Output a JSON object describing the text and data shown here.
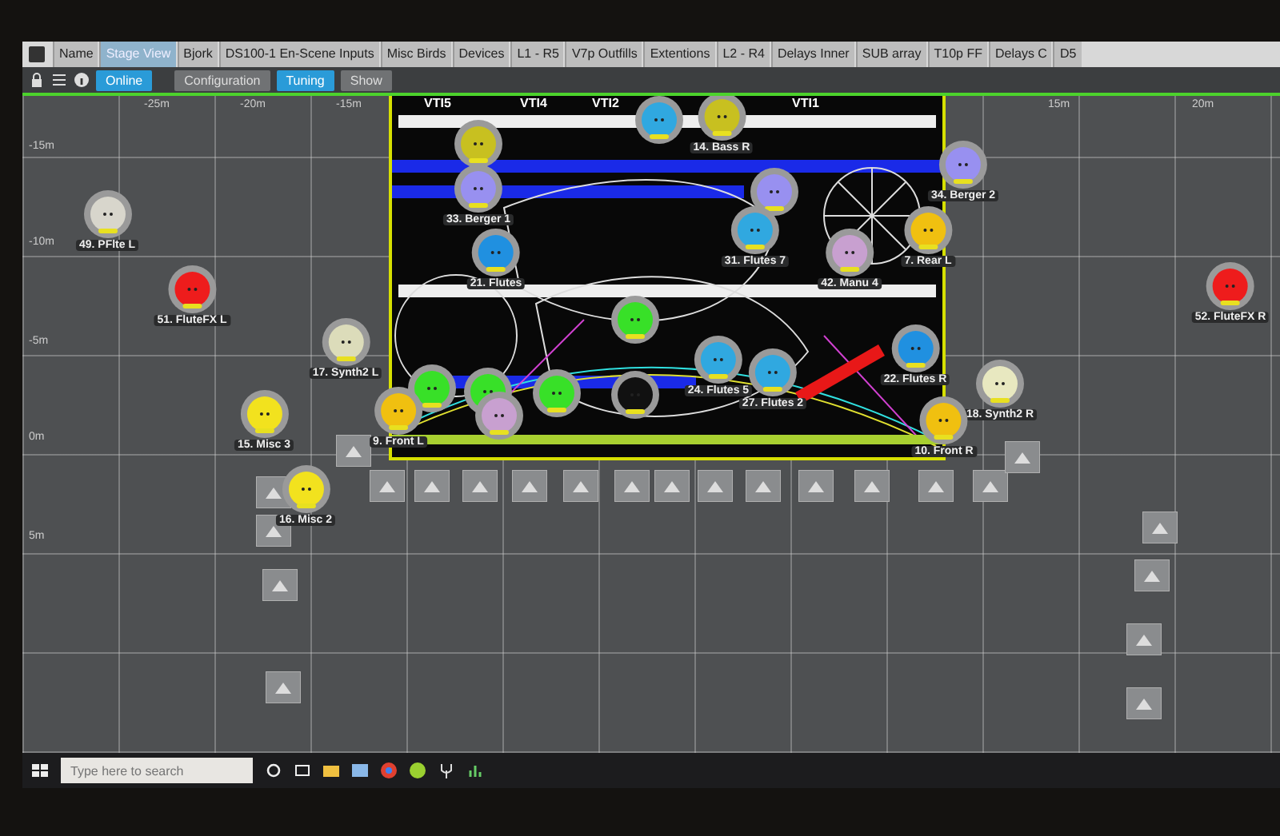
{
  "tabs": [
    {
      "label": "Name",
      "selected": false
    },
    {
      "label": "Stage View",
      "selected": true
    },
    {
      "label": "Bjork",
      "selected": false
    },
    {
      "label": "DS100-1 En-Scene Inputs",
      "selected": false
    },
    {
      "label": "Misc Birds",
      "selected": false
    },
    {
      "label": "Devices",
      "selected": false
    },
    {
      "label": "L1 - R5",
      "selected": false
    },
    {
      "label": "V7p Outfills",
      "selected": false
    },
    {
      "label": "Extentions",
      "selected": false
    },
    {
      "label": "L2 - R4",
      "selected": false
    },
    {
      "label": "Delays Inner",
      "selected": false
    },
    {
      "label": "SUB array",
      "selected": false
    },
    {
      "label": "T10p FF",
      "selected": false
    },
    {
      "label": "Delays C",
      "selected": false
    },
    {
      "label": "D5",
      "selected": false
    }
  ],
  "online": {
    "label": "Online",
    "on": true
  },
  "modes": [
    {
      "label": "Configuration",
      "selected": false
    },
    {
      "label": "Tuning",
      "selected": true
    },
    {
      "label": "Show",
      "selected": false
    }
  ],
  "x_ticks": [
    "-25m",
    "-20m",
    "-15m",
    "15m",
    "20m"
  ],
  "y_ticks": [
    "-15m",
    "-10m",
    "-5m",
    "0m",
    "5m"
  ],
  "stage_labels": [
    "VTI5",
    "VTI4",
    "VTI2",
    "VTI1"
  ],
  "nodes": [
    {
      "label": "49. PFlte L",
      "color": "#d8d6cc"
    },
    {
      "label": "51. FluteFX L",
      "color": "#ee1c1c"
    },
    {
      "label": "17. Synth2 L",
      "color": "#dcdcba"
    },
    {
      "label": "15. Misc 3",
      "color": "#f2e21e"
    },
    {
      "label": "16. Misc 2",
      "color": "#f2e21e"
    },
    {
      "label": "9. Front L",
      "color": "#f0c010"
    },
    {
      "label": "33. Berger 1",
      "color": "#9890f0"
    },
    {
      "label": "14. Bass R",
      "color": "#c8c020"
    },
    {
      "label": "21. Flutes",
      "color": "#2090e0"
    },
    {
      "label": "31. Flutes 7",
      "color": "#30a8e0"
    },
    {
      "label": "42. Manu 4",
      "color": "#c8a0d0"
    },
    {
      "label": "7. Rear L",
      "color": "#f0c010"
    },
    {
      "label": "34. Berger 2",
      "color": "#9890f0"
    },
    {
      "label": "22. Flutes R",
      "color": "#2090e0"
    },
    {
      "label": "24. Flutes 5",
      "color": "#30a8e0"
    },
    {
      "label": "27. Flutes 2",
      "color": "#30a8e0"
    },
    {
      "label": "18. Synth2 R",
      "color": "#e8e8c0"
    },
    {
      "label": "52. FluteFX R",
      "color": "#ee1c1c"
    },
    {
      "label": "10. Front R",
      "color": "#f0c010"
    }
  ],
  "unlabeled_nodes": [
    {
      "color": "#c8c020"
    },
    {
      "color": "#30a8e0"
    },
    {
      "color": "#38e028"
    },
    {
      "color": "#38e028"
    },
    {
      "color": "#38e028"
    },
    {
      "color": "#38e028"
    },
    {
      "color": "#c8a0d0"
    },
    {
      "color": "#111111"
    },
    {
      "color": "#9890f0"
    }
  ],
  "taskbar": {
    "search_placeholder": "Type here to search"
  }
}
